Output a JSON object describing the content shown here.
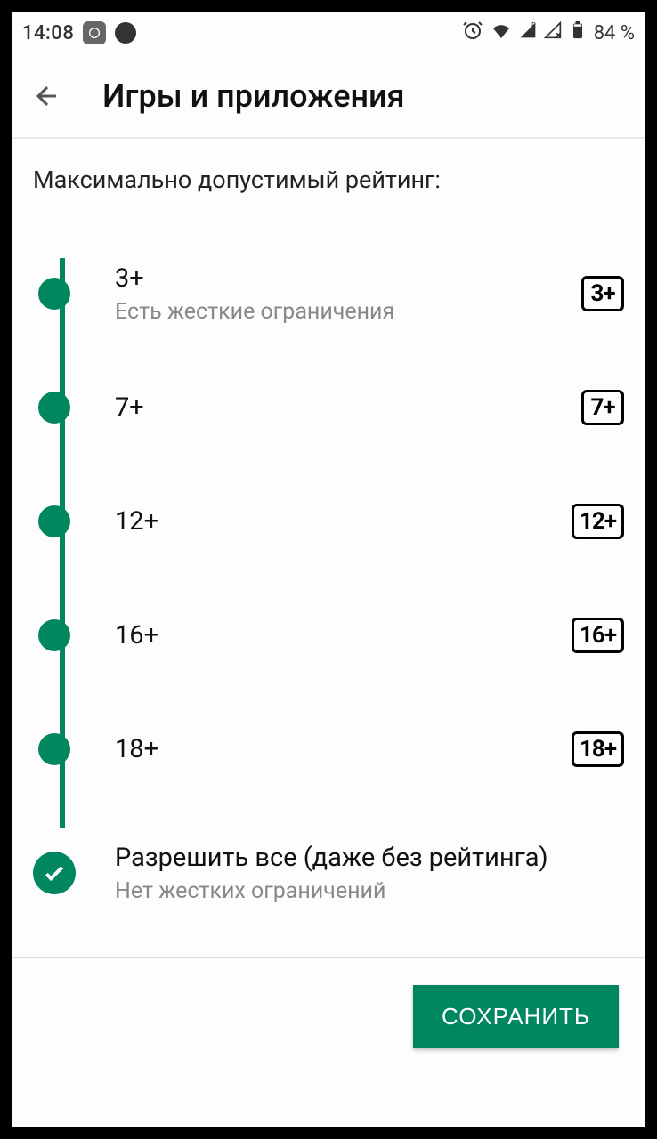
{
  "status": {
    "time": "14:08",
    "battery": "84 %"
  },
  "header": {
    "title": "Игры и приложения"
  },
  "section": {
    "heading": "Максимально допустимый рейтинг:"
  },
  "ratings": [
    {
      "label": "3+",
      "sub": "Есть жесткие ограничения",
      "badge": "3+",
      "selected": false
    },
    {
      "label": "7+",
      "sub": "",
      "badge": "7+",
      "selected": false
    },
    {
      "label": "12+",
      "sub": "",
      "badge": "12+",
      "selected": false
    },
    {
      "label": "16+",
      "sub": "",
      "badge": "16+",
      "selected": false
    },
    {
      "label": "18+",
      "sub": "",
      "badge": "18+",
      "selected": false
    },
    {
      "label": "Разрешить все (даже без рейтинга)",
      "sub": "Нет жестких ограничений",
      "badge": "",
      "selected": true
    }
  ],
  "actions": {
    "save": "СОХРАНИТЬ"
  },
  "colors": {
    "accent": "#00875f"
  }
}
